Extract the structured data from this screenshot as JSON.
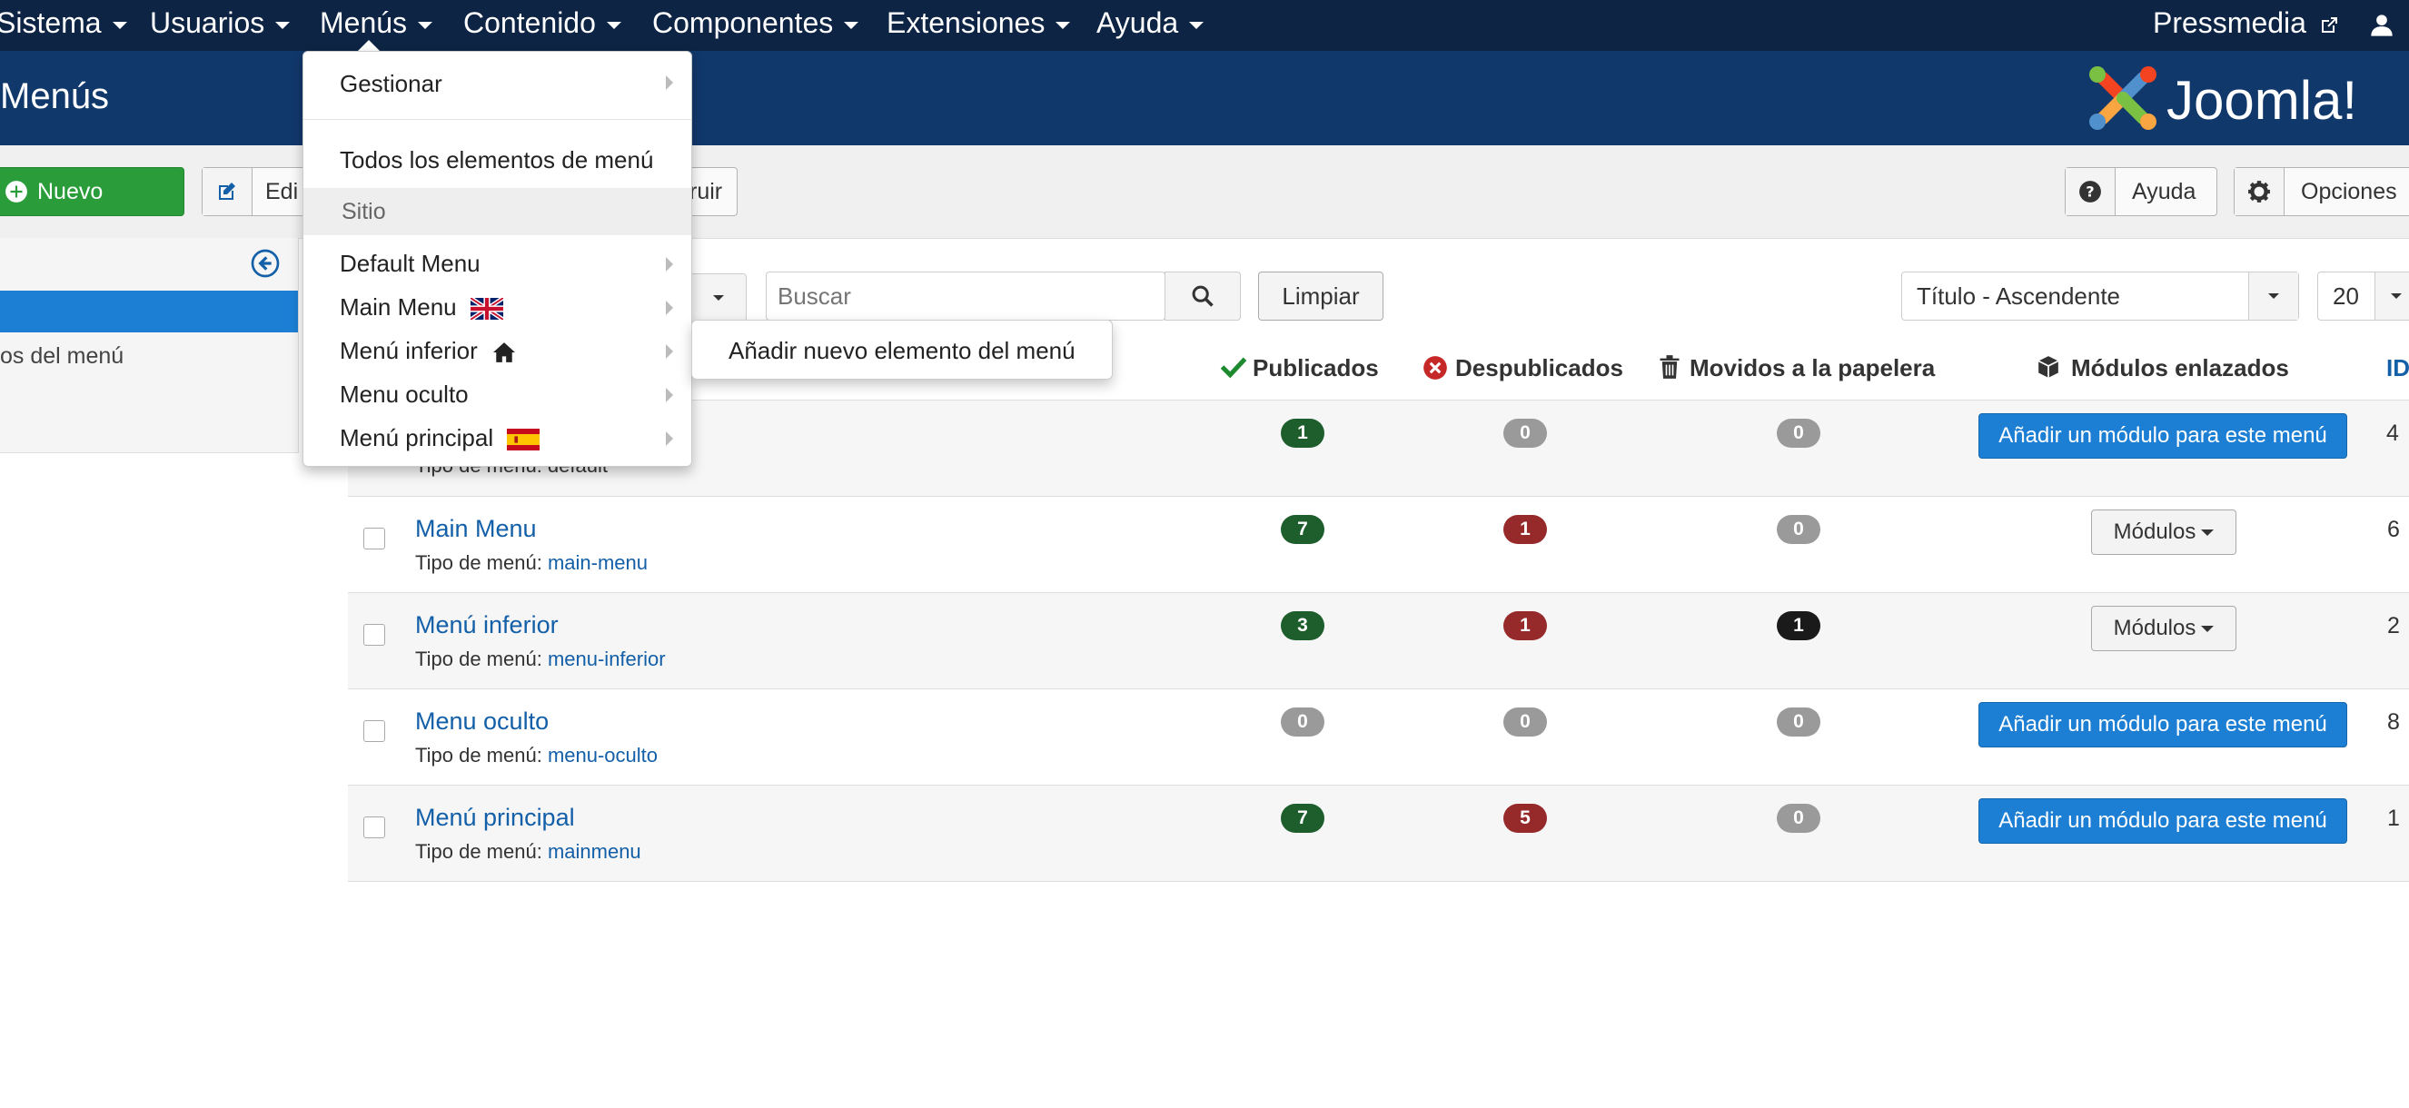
{
  "topnav": {
    "items": [
      {
        "label": "Sistema"
      },
      {
        "label": "Usuarios"
      },
      {
        "label": "Menús"
      },
      {
        "label": "Contenido"
      },
      {
        "label": "Componentes"
      },
      {
        "label": "Extensiones"
      },
      {
        "label": "Ayuda"
      }
    ],
    "site_label": "Pressmedia",
    "brand": "Joomla!"
  },
  "header": {
    "title": "Menús"
  },
  "toolbar": {
    "new_label": "Nuevo",
    "edit_label": "Edi",
    "build_label": "ruir",
    "help_label": "Ayuda",
    "options_label": "Opciones"
  },
  "sidebar": {
    "item_label": "os del menú"
  },
  "filters": {
    "search_placeholder": "Buscar",
    "clear_label": "Limpiar",
    "sort_value": "Título - Ascendente",
    "limit_value": "20"
  },
  "table": {
    "headers": {
      "published": "Publicados",
      "unpublished": "Despublicados",
      "trashed": "Movidos a la papelera",
      "modules": "Módulos enlazados",
      "id": "ID"
    },
    "type_prefix": "Tipo de menú:",
    "first_row_type_partial": "Tipo de menú: default",
    "add_module_label": "Añadir un módulo para este menú",
    "modules_button_label": "Módulos",
    "first_row": {
      "published": "1",
      "unpublished": "0",
      "trashed": "0",
      "id": "4"
    },
    "rows": [
      {
        "title": "Main Menu",
        "type": "main-menu",
        "published": "7",
        "unpublished": "1",
        "trashed": "0",
        "id": "6"
      },
      {
        "title": "Menú inferior",
        "type": "menu-inferior",
        "published": "3",
        "unpublished": "1",
        "trashed": "1",
        "id": "2"
      },
      {
        "title": "Menu oculto",
        "type": "menu-oculto",
        "published": "0",
        "unpublished": "0",
        "trashed": "0",
        "id": "8"
      },
      {
        "title": "Menú principal",
        "type": "mainmenu",
        "published": "7",
        "unpublished": "5",
        "trashed": "0",
        "id": "1"
      }
    ]
  },
  "dropdown": {
    "manage": "Gestionar",
    "all_items": "Todos los elementos de menú",
    "site_header": "Sitio",
    "menus": [
      {
        "label": "Default Menu"
      },
      {
        "label": "Main Menu"
      },
      {
        "label": "Menú inferior"
      },
      {
        "label": "Menu oculto"
      },
      {
        "label": "Menú principal"
      }
    ],
    "submenu_add": "Añadir nuevo elemento del menú"
  },
  "colors": {
    "nav_bg": "#0d2444",
    "header_bg": "#11386b",
    "new_button": "#2a9d3a",
    "link": "#135fa8",
    "add_module_button": "#1c7fd4",
    "badge_published": "#1e5d2c",
    "badge_unpublished": "#962a2a"
  }
}
